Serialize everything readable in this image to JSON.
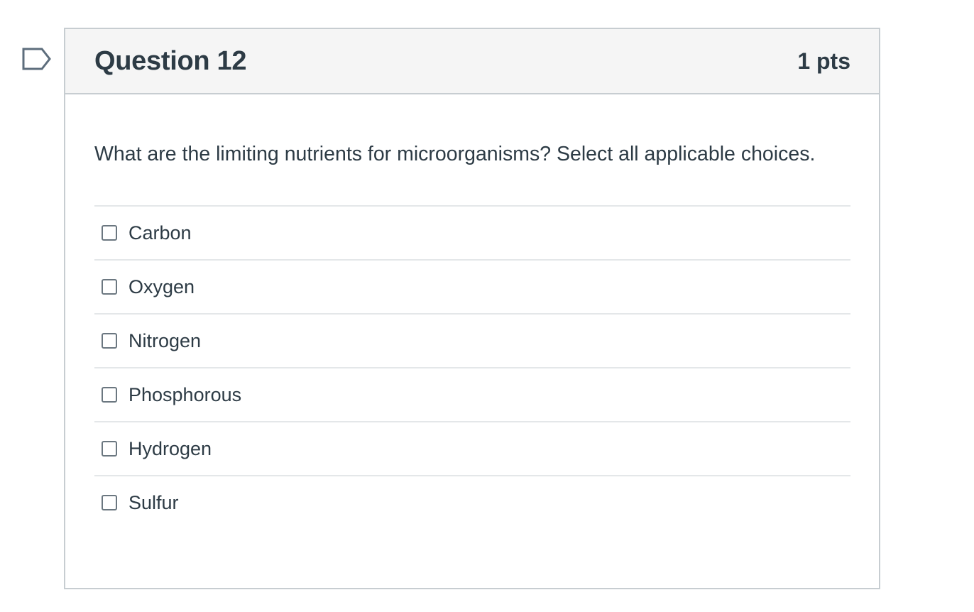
{
  "question": {
    "title": "Question 12",
    "points": "1 pts",
    "text": "What are the limiting nutrients for microorganisms? Select all applicable choices.",
    "flag_icon": "flag-question-icon",
    "answers": [
      {
        "label": "Carbon",
        "checked": false
      },
      {
        "label": "Oxygen",
        "checked": false
      },
      {
        "label": "Nitrogen",
        "checked": false
      },
      {
        "label": "Phosphorous",
        "checked": false
      },
      {
        "label": "Hydrogen",
        "checked": false
      },
      {
        "label": "Sulfur",
        "checked": false
      }
    ]
  },
  "colors": {
    "text": "#2d3b45",
    "border": "#c7cdd1",
    "header_bg": "#f5f5f5",
    "divider": "#e4e7e9",
    "flag": "#5d6d7c"
  }
}
